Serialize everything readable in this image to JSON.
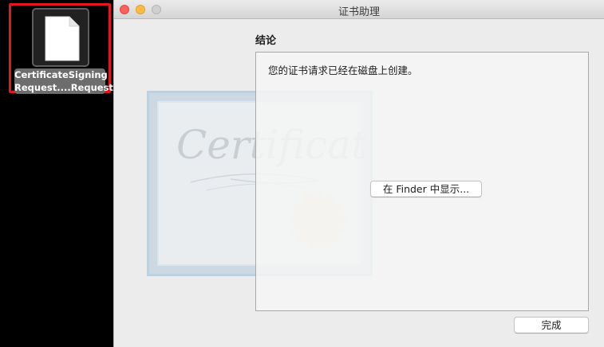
{
  "desktop": {
    "file": {
      "icon": "document-icon",
      "label_line1": "CertificateSigning",
      "label_line2": "Request....Request"
    }
  },
  "window": {
    "title": "证书助理",
    "section_title": "结论",
    "message": "您的证书请求已经在磁盘上创建。",
    "show_in_finder_label": "在 Finder 中显示...",
    "done_label": "完成",
    "background_art_text": "Certificate"
  },
  "colors": {
    "highlight": "#e3171e",
    "close": "#fc605c",
    "minimize": "#fdbc40"
  }
}
